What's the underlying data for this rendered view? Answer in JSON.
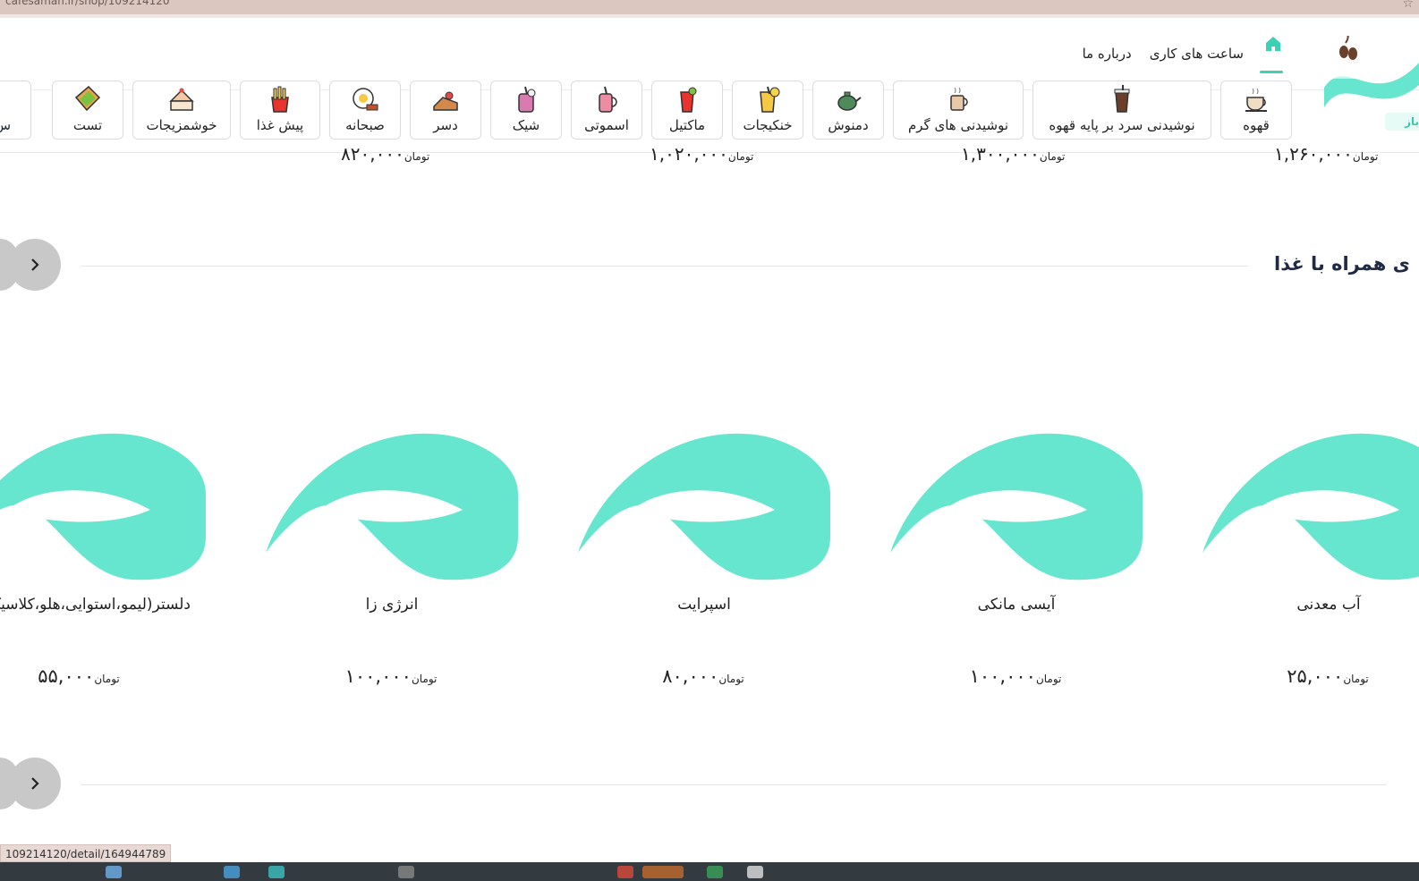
{
  "browser": {
    "url": "cafesaman.ir/shop/109214120",
    "status_url": "109214120/detail/164944789"
  },
  "header": {
    "open_badge": "باز",
    "nav": [
      "ساعت های کاری",
      "درباره ما"
    ]
  },
  "categories": [
    {
      "label": "قهوه",
      "icon": "coffee-cup-icon"
    },
    {
      "label": "نوشیدنی سرد بر پایه قهوه",
      "icon": "iced-coffee-icon"
    },
    {
      "label": "نوشیدنی های گرم",
      "icon": "hot-drink-icon"
    },
    {
      "label": "دمنوش",
      "icon": "teapot-icon"
    },
    {
      "label": "خنکیجات",
      "icon": "cold-drink-icon"
    },
    {
      "label": "ماکتیل",
      "icon": "mocktail-icon"
    },
    {
      "label": "اسموتی",
      "icon": "smoothie-icon"
    },
    {
      "label": "شیک",
      "icon": "shake-icon"
    },
    {
      "label": "دسر",
      "icon": "dessert-icon"
    },
    {
      "label": "صبحانه",
      "icon": "breakfast-icon"
    },
    {
      "label": "پیش غذا",
      "icon": "fries-icon"
    },
    {
      "label": "خوشمزیجات",
      "icon": "cake-icon"
    },
    {
      "label": "تست",
      "icon": "toast-icon"
    },
    {
      "label": "س",
      "icon": "partial-icon"
    }
  ],
  "previous_prices": [
    {
      "amount": "۱,۲۶۰,۰۰۰",
      "currency": "تومان"
    },
    {
      "amount": "۱,۳۰۰,۰۰۰",
      "currency": "تومان"
    },
    {
      "amount": "۱,۰۲۰,۰۰۰",
      "currency": "تومان"
    },
    {
      "amount": "۸۲۰,۰۰۰",
      "currency": "تومان"
    }
  ],
  "section": {
    "title": "ی همراه با غذا"
  },
  "products": [
    {
      "name": "آب معدنی",
      "price": "۲۵,۰۰۰",
      "currency": "تومان"
    },
    {
      "name": "آیسی مانکی",
      "price": "۱۰۰,۰۰۰",
      "currency": "تومان"
    },
    {
      "name": "اسپرایت",
      "price": "۸۰,۰۰۰",
      "currency": "تومان"
    },
    {
      "name": "انرژی زا",
      "price": "۱۰۰,۰۰۰",
      "currency": "تومان"
    },
    {
      "name": "دلستر(لیمو،استوایی،هلو،کلاسیک)",
      "price": "۵۵,۰۰۰",
      "currency": "تومان"
    }
  ],
  "colors": {
    "brand": "#66e6cf",
    "accent": "#3ed0b4",
    "title": "#1f2a44"
  }
}
